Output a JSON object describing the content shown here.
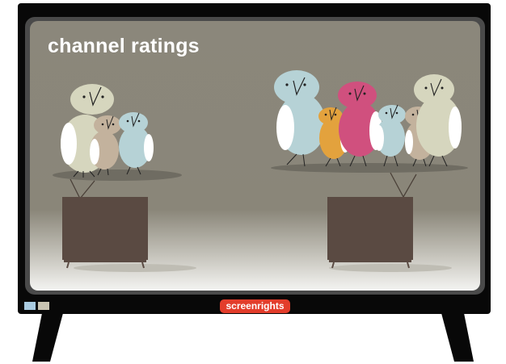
{
  "screen": {
    "title": "channel ratings"
  },
  "brand": {
    "badge_label": "screenrights",
    "badge_color": "#e33d2b"
  },
  "indicators": [
    {
      "color": "#a9cbe0"
    },
    {
      "color": "#c9c4b2"
    }
  ],
  "colors": {
    "wall": "#8a8679",
    "tv_cabinet": "#5a4a42",
    "bird_blue": "#b6d2d6",
    "bird_cream": "#d6d6be",
    "bird_tan": "#c3b29d",
    "bird_orange": "#e3a23d",
    "bird_pink": "#d0507e"
  }
}
